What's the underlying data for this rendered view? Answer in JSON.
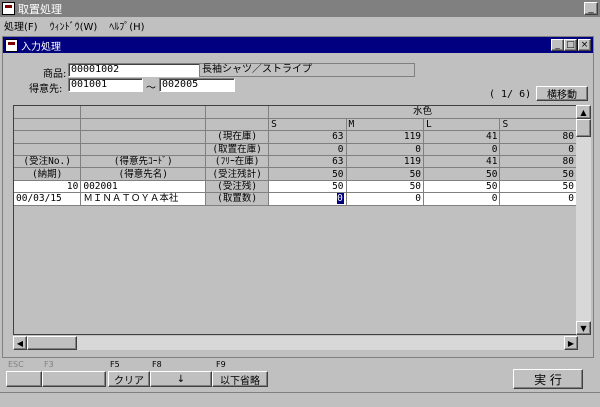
{
  "window": {
    "title": "取置処理"
  },
  "menu": [
    "処理(F)",
    "ｳｨﾝﾄﾞｳ(W)",
    "ﾍﾙﾌﾟ(H)"
  ],
  "inner": {
    "title": "入力処理",
    "minimize": "_",
    "maximize": "□",
    "close": "×"
  },
  "form": {
    "product_label": "商品:",
    "product_code": "00001002",
    "product_name": "長袖シャツ／ストライプ",
    "customer_label": "得意先:",
    "customer_from": "001001",
    "range_sep": "〜",
    "customer_to": "002005",
    "page_indicator": "(  1/  6)",
    "scroll_button": "横移動"
  },
  "grid": {
    "color_header": "水色",
    "sizes": [
      "S",
      "M",
      "L",
      "S"
    ],
    "rows": [
      {
        "a": "",
        "b": "",
        "label": "(現在庫)",
        "v": [
          "63",
          "119",
          "41",
          "80"
        ]
      },
      {
        "a": "",
        "b": "",
        "label": "(取置在庫)",
        "v": [
          "0",
          "0",
          "0",
          "0"
        ]
      },
      {
        "a": "(受注No.)",
        "b": "(得意先ｺｰﾄﾞ)",
        "label": "(ﾌﾘｰ在庫)",
        "v": [
          "63",
          "119",
          "41",
          "80"
        ]
      },
      {
        "a": "(納期)",
        "b": "(得意先名)",
        "label": "(受注残計)",
        "v": [
          "50",
          "50",
          "50",
          "50"
        ]
      }
    ],
    "data_rows": [
      {
        "a": "10",
        "b": "002001",
        "label": "(受注残)",
        "v": [
          "50",
          "50",
          "50",
          "50"
        ]
      },
      {
        "a": "00/03/15",
        "b": "ＭＩＮＡＴＯＹＡ本社",
        "label": "(取置数)",
        "v": [
          "0",
          "0",
          "0",
          "0"
        ]
      }
    ]
  },
  "fkeys": [
    {
      "key": "ESC",
      "label": "",
      "enabled": false
    },
    {
      "key": "F3",
      "label": "",
      "enabled": false
    },
    {
      "key": "F5",
      "label": "クリア",
      "enabled": true
    },
    {
      "key": "F8",
      "label": "↓",
      "enabled": true
    },
    {
      "key": "F9",
      "label": "以下省略",
      "enabled": true
    }
  ],
  "execute_button": "実 行",
  "colors": {
    "inner_title": "#000080",
    "outer_title": "#808080",
    "face": "#c0c0c0"
  }
}
